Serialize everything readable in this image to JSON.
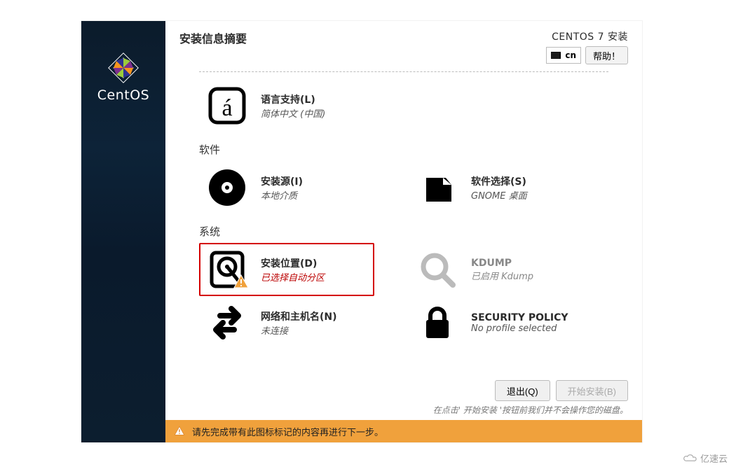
{
  "header": {
    "page_title": "安装信息摘要",
    "product_name": "CENTOS 7 安装",
    "keyboard_layout": "cn",
    "help_label": "帮助！"
  },
  "sidebar": {
    "brand": "CentOS"
  },
  "categories": {
    "localization": {
      "language_support": {
        "title": "语言支持(L)",
        "subtitle": "简体中文 (中国)"
      }
    },
    "software": {
      "label": "软件",
      "installation_source": {
        "title": "安装源(I)",
        "subtitle": "本地介质"
      },
      "software_selection": {
        "title": "软件选择(S)",
        "subtitle": "GNOME 桌面"
      }
    },
    "system": {
      "label": "系统",
      "installation_destination": {
        "title": "安装位置(D)",
        "subtitle": "已选择自动分区"
      },
      "kdump": {
        "title": "KDUMP",
        "subtitle": "已启用 Kdump"
      },
      "network_hostname": {
        "title": "网络和主机名(N)",
        "subtitle": "未连接"
      },
      "security_policy": {
        "title": "SECURITY POLICY",
        "subtitle": "No profile selected"
      }
    }
  },
  "footer": {
    "quit_label": "退出(Q)",
    "begin_label": "开始安装(B)",
    "note": "在点击' 开始安装 '按钮前我们并不会操作您的磁盘。"
  },
  "warning_bar": {
    "message": "请先完成带有此图标标记的内容再进行下一步。"
  },
  "watermark": "亿速云"
}
